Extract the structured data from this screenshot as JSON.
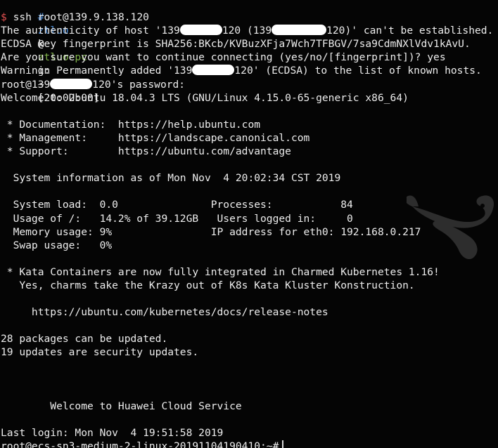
{
  "prompt": {
    "hash": "#",
    "user": "ztluo",
    "at": "@",
    "host": "ztluo-pc",
    "in_text": "in",
    "path": "~",
    "time": "[20:02:00]",
    "dollar": "$",
    "command": "ssh root@139.9.138.120"
  },
  "auth": {
    "line1_prefix": "The authenticity of host '139",
    "line1_mid1": "120 (139",
    "line1_mid2": "120)' can't be established.",
    "line2": "ECDSA key fingerprint is SHA256:BKcb/KVBuzXFja7Wch7TFBGV/7sa9CdmNXlVdv1kAvU.",
    "line3": "Are you sure you want to continue connecting (yes/no/[fingerprint])? yes",
    "line4_prefix": "Warning: Permanently added '139",
    "line4_suffix": "120' (ECDSA) to the list of known hosts.",
    "password_prefix": "root@139",
    "password_suffix": "120's password:"
  },
  "motd": {
    "welcome": "Welcome to Ubuntu 18.04.3 LTS (GNU/Linux 4.15.0-65-generic x86_64)",
    "documentation": " * Documentation:  https://help.ubuntu.com",
    "management": " * Management:     https://landscape.canonical.com",
    "support": " * Support:        https://ubuntu.com/advantage",
    "system_info": "  System information as of Mon Nov  4 20:02:34 CST 2019",
    "stats": [
      "  System load:  0.0               Processes:           84",
      "  Usage of /:   14.2% of 39.12GB   Users logged in:     0",
      "  Memory usage: 9%                IP address for eth0: 192.168.0.217",
      "  Swap usage:   0%"
    ],
    "kata_line1": " * Kata Containers are now fully integrated in Charmed Kubernetes 1.16!",
    "kata_line2": "   Yes, charms take the Krazy out of K8s Kata Kluster Konstruction.",
    "release_notes": "     https://ubuntu.com/kubernetes/docs/release-notes",
    "packages": "28 packages can be updated.",
    "security": "19 updates are security updates.",
    "huawei": "        Welcome to Huawei Cloud Service",
    "last_login": "Last login: Mon Nov  4 19:51:58 2019",
    "final_prompt": "root@ecs-sn3-medium-2-linux-20191104190410:~#"
  },
  "colors": {
    "background": "#050505",
    "text": "#ededed",
    "prompt_blue": "#4f8fda",
    "prompt_green": "#7fb24a",
    "dollar_red": "#e25050",
    "redaction": "#ffffff"
  },
  "icons": {
    "mascot": "mouse-mascot-icon",
    "cursor": "text-cursor-icon"
  }
}
